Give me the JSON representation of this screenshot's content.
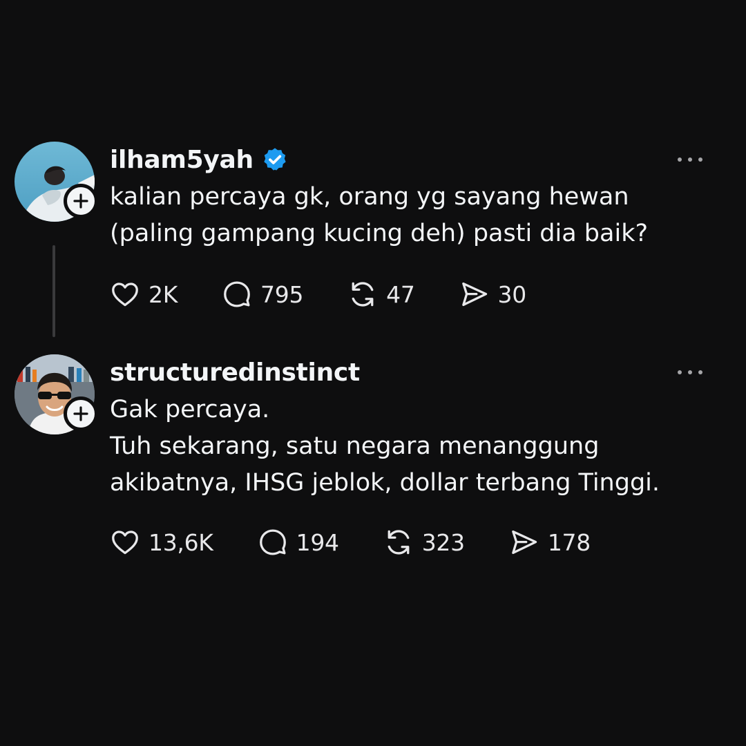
{
  "posts": [
    {
      "username": "ilham5yah",
      "verified": true,
      "text_lines": [
        "kalian percaya gk, orang yg sayang hewan",
        "(paling gampang kucing deh) pasti dia baik?"
      ],
      "stats": {
        "likes": "2K",
        "replies": "795",
        "reposts": "47",
        "shares": "30"
      }
    },
    {
      "username": "structuredinstinct",
      "verified": false,
      "text_lines": [
        "Gak percaya.",
        "Tuh sekarang, satu negara menanggung",
        "akibatnya, IHSG jeblok, dollar terbang Tinggi."
      ],
      "stats": {
        "likes": "13,6K",
        "replies": "194",
        "reposts": "323",
        "shares": "178"
      }
    }
  ],
  "icons": {
    "verified": "verified-badge-icon",
    "follow": "plus-icon",
    "more": "more-options-icon",
    "like": "heart-icon",
    "reply": "speech-bubble-icon",
    "repost": "repost-icon",
    "share": "paper-plane-icon"
  },
  "colors": {
    "background": "#0e0e0f",
    "text": "#f3f5f7",
    "verified_blue": "#1d9bf0",
    "muted": "#a5a5a8",
    "thread_line": "#3a3a3c"
  }
}
